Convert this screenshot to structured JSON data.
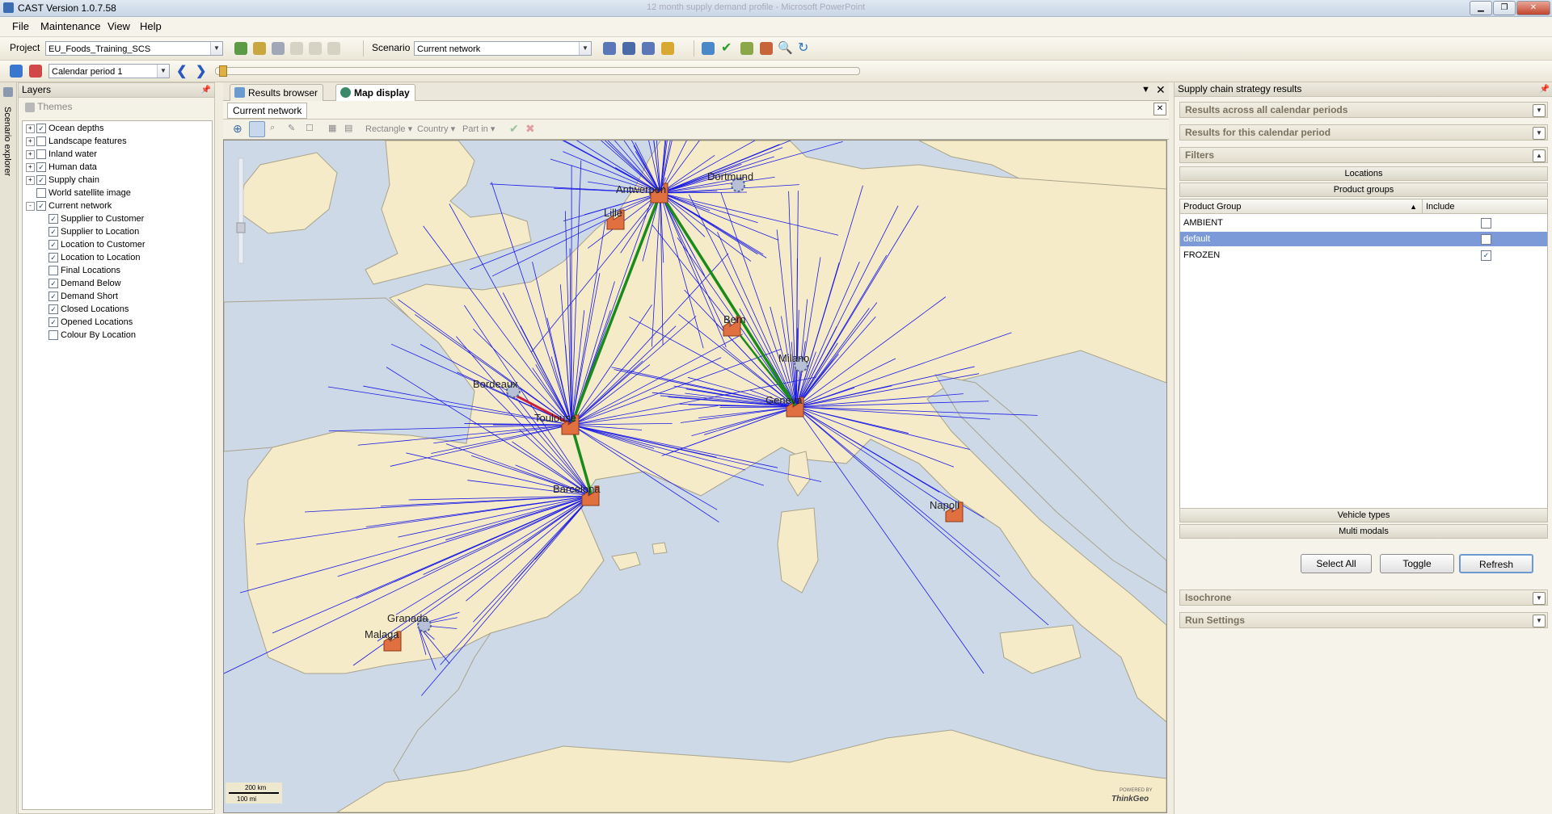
{
  "window": {
    "title": "CAST Version 1.0.7.58",
    "background_title": "12 month supply demand profile - Microsoft PowerPoint"
  },
  "menu": [
    {
      "label": "File"
    },
    {
      "label": "Maintenance"
    },
    {
      "label": "View"
    },
    {
      "label": "Help"
    }
  ],
  "toolbar": {
    "project_label": "Project",
    "project_value": "EU_Foods_Training_SCS",
    "scenario_label": "Scenario",
    "scenario_value": "Current network",
    "period_value": "Calendar period 1"
  },
  "layers_panel": {
    "title": "Layers",
    "themes_label": "Themes",
    "side_tab": "Scenario explorer",
    "tree": [
      {
        "label": "Ocean depths",
        "checked": true,
        "expand": "+"
      },
      {
        "label": "Landscape features",
        "checked": false,
        "expand": "+"
      },
      {
        "label": "Inland water",
        "checked": false,
        "expand": "+"
      },
      {
        "label": "Human data",
        "checked": true,
        "expand": "+"
      },
      {
        "label": "Supply chain",
        "checked": true,
        "expand": "+"
      },
      {
        "label": "World satellite image",
        "checked": false,
        "expand": ""
      },
      {
        "label": "Current network",
        "checked": true,
        "expand": "-"
      }
    ],
    "subtree": [
      {
        "label": "Supplier to Customer",
        "checked": true
      },
      {
        "label": "Supplier to Location",
        "checked": true
      },
      {
        "label": "Location to Customer",
        "checked": true
      },
      {
        "label": "Location to Location",
        "checked": true
      },
      {
        "label": "Final Locations",
        "checked": false
      },
      {
        "label": "Demand Below",
        "checked": true
      },
      {
        "label": "Demand Short",
        "checked": true
      },
      {
        "label": "Closed Locations",
        "checked": true
      },
      {
        "label": "Opened Locations",
        "checked": true
      },
      {
        "label": "Colour By Location",
        "checked": false
      }
    ]
  },
  "map_panel": {
    "tabs": [
      {
        "label": "Results browser"
      },
      {
        "label": "Map display"
      }
    ],
    "subtab": "Current network",
    "tools": {
      "rectangle": "Rectangle",
      "country": "Country",
      "part_in": "Part in"
    },
    "scale_km": "200 km",
    "scale_mi": "100 mi",
    "credit_top": "POWERED BY",
    "credit_brand": "ThinkGeo",
    "cities": [
      {
        "name": "Antwerpen"
      },
      {
        "name": "Dortmund"
      },
      {
        "name": "Lille"
      },
      {
        "name": "Bern"
      },
      {
        "name": "Milano"
      },
      {
        "name": "Geneva"
      },
      {
        "name": "Bordeaux"
      },
      {
        "name": "Toulouse"
      },
      {
        "name": "Barcelona"
      },
      {
        "name": "Napoli"
      },
      {
        "name": "Granada"
      },
      {
        "name": "Malaga"
      }
    ]
  },
  "right_panel": {
    "title": "Supply chain strategy results",
    "sections": {
      "across": "Results across all calendar periods",
      "this_period": "Results for this calendar period",
      "filters": "Filters",
      "isochrone": "Isochrone",
      "run_settings": "Run Settings"
    },
    "bars": {
      "locations": "Locations",
      "product_groups": "Product groups",
      "vehicle_types": "Vehicle types",
      "multi_modals": "Multi modals"
    },
    "grid": {
      "col_group": "Product Group",
      "col_include": "Include",
      "rows": [
        {
          "name": "AMBIENT",
          "include": false,
          "selected": false
        },
        {
          "name": "default",
          "include": false,
          "selected": true
        },
        {
          "name": "FROZEN",
          "include": true,
          "selected": false
        }
      ]
    },
    "buttons": {
      "select_all": "Select All",
      "toggle": "Toggle",
      "refresh": "Refresh"
    }
  },
  "colors": {
    "flow_line": "#1a1ae6",
    "trunk_line": "#1a8a1a",
    "alt_line": "#c81e3c",
    "land": "#f5ebc8",
    "sea": "#cdd9e6"
  }
}
